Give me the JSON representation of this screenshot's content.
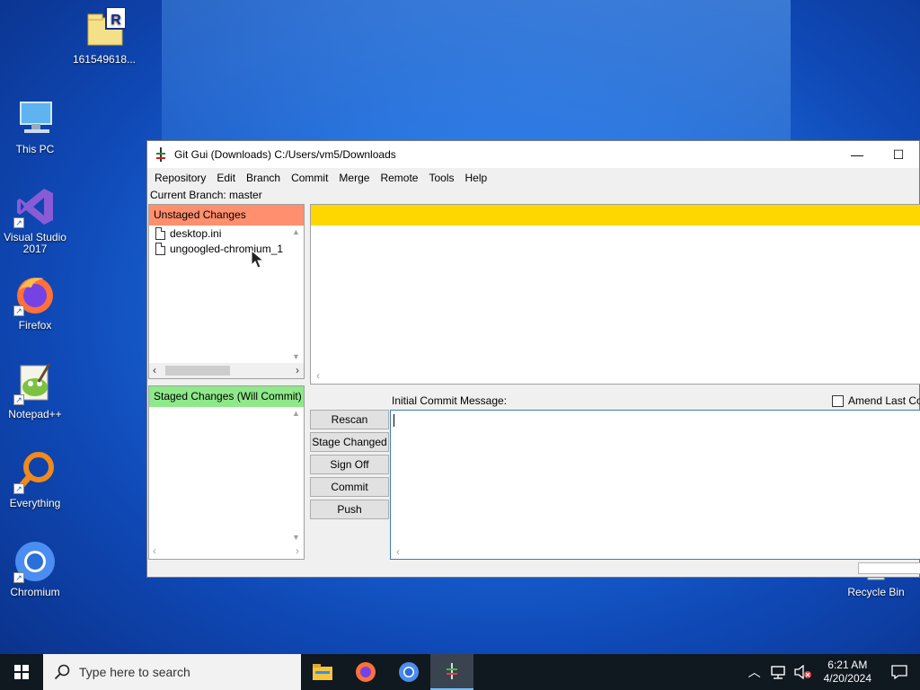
{
  "desktop": {
    "icons": [
      {
        "label": "161549618..."
      },
      {
        "label": "This PC"
      },
      {
        "label": "Visual Studio 2017"
      },
      {
        "label": "Firefox"
      },
      {
        "label": "Notepad++"
      },
      {
        "label": "Everything"
      },
      {
        "label": "Chromium"
      },
      {
        "label": "Recycle Bin"
      }
    ]
  },
  "window": {
    "title": "Git Gui (Downloads) C:/Users/vm5/Downloads",
    "menu": [
      "Repository",
      "Edit",
      "Branch",
      "Commit",
      "Merge",
      "Remote",
      "Tools",
      "Help"
    ],
    "current_branch": "Current Branch: master",
    "unstaged": {
      "header": "Unstaged Changes",
      "color": "#ff8f6e",
      "files": [
        "desktop.ini",
        "ungoogled-chromium_1"
      ]
    },
    "staged": {
      "header": "Staged Changes (Will Commit)",
      "color": "#8fe88a",
      "files": []
    },
    "diff_header_color": "#ffd700",
    "commit_message_label": "Initial Commit Message:",
    "amend_label": "Amend Last Co",
    "buttons": [
      "Rescan",
      "Stage Changed",
      "Sign Off",
      "Commit",
      "Push"
    ]
  },
  "taskbar": {
    "search_placeholder": "Type here to search",
    "time": "6:21 AM",
    "date": "4/20/2024"
  }
}
